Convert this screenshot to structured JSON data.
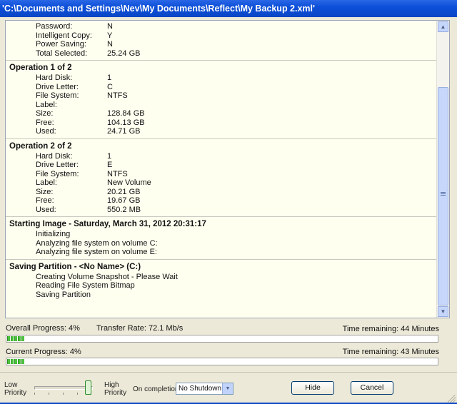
{
  "window": {
    "title": "'C:\\Documents and Settings\\Nev\\My Documents\\Reflect\\My Backup 2.xml'"
  },
  "log": {
    "summary": [
      {
        "key": "Password:",
        "value": "N"
      },
      {
        "key": "Intelligent Copy:",
        "value": "Y"
      },
      {
        "key": "Power Saving:",
        "value": "N"
      },
      {
        "key": "Total Selected:",
        "value": "25.24 GB"
      }
    ],
    "op1": {
      "heading": "Operation 1 of 2",
      "rows": [
        {
          "key": "Hard Disk:",
          "value": "1"
        },
        {
          "key": "Drive Letter:",
          "value": "C"
        },
        {
          "key": "File System:",
          "value": "NTFS"
        },
        {
          "key": "Label:",
          "value": ""
        },
        {
          "key": "Size:",
          "value": "128.84 GB"
        },
        {
          "key": "Free:",
          "value": "104.13 GB"
        },
        {
          "key": "Used:",
          "value": "24.71 GB"
        }
      ]
    },
    "op2": {
      "heading": "Operation 2 of 2",
      "rows": [
        {
          "key": "Hard Disk:",
          "value": "1"
        },
        {
          "key": "Drive Letter:",
          "value": "E"
        },
        {
          "key": "File System:",
          "value": "NTFS"
        },
        {
          "key": "Label:",
          "value": "New Volume"
        },
        {
          "key": "Size:",
          "value": "20.21 GB"
        },
        {
          "key": "Free:",
          "value": "19.67 GB"
        },
        {
          "key": "Used:",
          "value": "550.2 MB"
        }
      ]
    },
    "starting": {
      "heading": "Starting Image - Saturday, March 31, 2012 20:31:17",
      "lines": [
        "Initializing",
        "Analyzing file system on volume C:",
        "Analyzing file system on volume E:"
      ]
    },
    "saving": {
      "heading": "Saving Partition - <No Name> (C:)",
      "lines": [
        "Creating Volume Snapshot - Please Wait",
        "Reading File System Bitmap",
        "Saving Partition"
      ]
    }
  },
  "progress": {
    "overall_label": "Overall Progress:  4%",
    "overall_value": 4,
    "transfer_rate": "Transfer Rate: 72.1 Mb/s",
    "overall_remaining": "Time remaining: 44 Minutes",
    "current_label": "Current Progress:  4%",
    "current_value": 4,
    "current_remaining": "Time remaining: 43 Minutes"
  },
  "priority": {
    "low_line1": "Low",
    "low_line2": "Priority",
    "high_line1": "High",
    "high_line2": "Priority",
    "level": 1.0
  },
  "completion": {
    "label": "On completion",
    "selected": "No Shutdown"
  },
  "buttons": {
    "hide": "Hide",
    "cancel": "Cancel"
  },
  "icons": {
    "scroll_up": "scroll-up-arrow-icon",
    "scroll_down": "scroll-down-arrow-icon",
    "dropdown": "chevron-down-icon"
  },
  "colors": {
    "title_bar": "#0a46c6",
    "progress_fill": "#4cc23c",
    "log_background": "#fffff0"
  }
}
